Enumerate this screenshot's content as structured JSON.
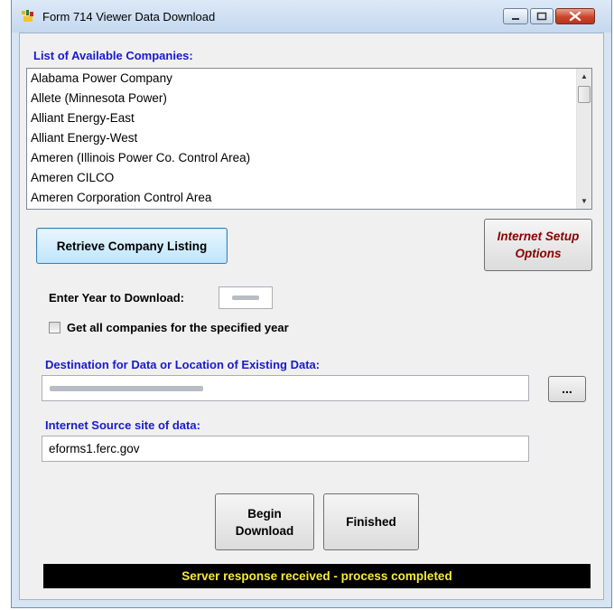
{
  "window": {
    "title": "Form 714 Viewer Data Download"
  },
  "companies": {
    "label": "List of Available Companies:",
    "items": [
      "Alabama Power Company",
      "Allete (Minnesota Power)",
      "Alliant Energy-East",
      "Alliant Energy-West",
      "Ameren (Illinois Power Co. Control Area)",
      "Ameren CILCO",
      "Ameren Corporation Control Area"
    ]
  },
  "buttons": {
    "retrieve": "Retrieve Company Listing",
    "internet_setup_line1": "Internet Setup",
    "internet_setup_line2": "Options",
    "browse": "...",
    "begin_line1": "Begin",
    "begin_line2": "Download",
    "finished": "Finished"
  },
  "year": {
    "label": "Enter Year to Download:",
    "value": ""
  },
  "all_companies": {
    "label": "Get all companies for the specified year",
    "checked": false
  },
  "destination": {
    "label": "Destination for Data or Location of Existing Data:",
    "value": ""
  },
  "source": {
    "label": "Internet Source site of data:",
    "value": "eforms1.ferc.gov"
  },
  "status": {
    "text": "Server response received - process completed",
    "bg_color": "#000000",
    "text_color": "#f5ea3a"
  },
  "colors": {
    "label_blue": "#1a1acb",
    "internet_button_text": "#8b0000"
  }
}
